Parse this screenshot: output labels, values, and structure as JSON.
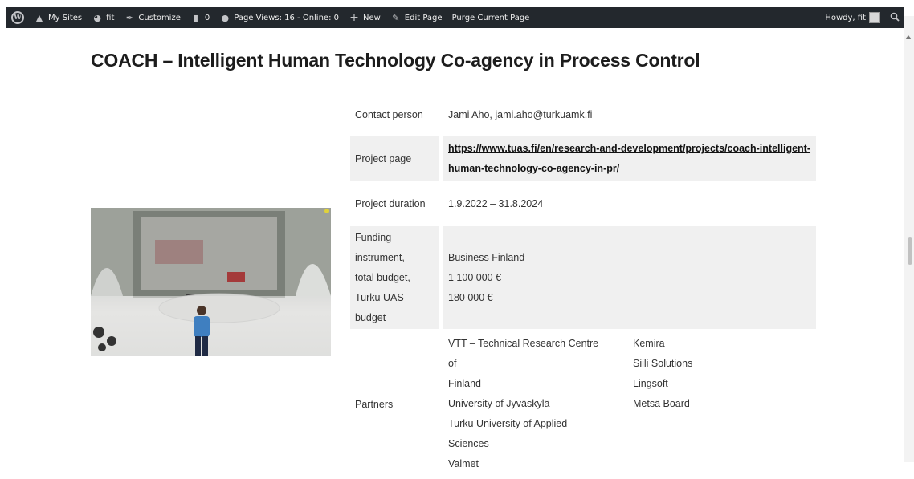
{
  "adminbar": {
    "my_sites": "My Sites",
    "site": "fit",
    "customize": "Customize",
    "comments_count": "0",
    "page_views": "Page Views: 16 - Online: 0",
    "new": "New",
    "edit_page": "Edit Page",
    "purge": "Purge Current Page",
    "howdy": "Howdy, fit"
  },
  "page": {
    "title": "COACH – Intelligent Human Technology Co-agency in Process Control"
  },
  "details": {
    "contact": {
      "label": "Contact person",
      "value": "Jami Aho, jami.aho@turkuamk.fi"
    },
    "project_page": {
      "label": "Project page",
      "link_line1": "https://www.tuas.fi/en/research-and-development/projects/coach-intelligent-",
      "link_line2": "human-technology-co-agency-in-pr/"
    },
    "duration": {
      "label": "Project duration",
      "value": "1.9.2022 – 31.8.2024"
    },
    "funding": {
      "label_lines": [
        "Funding",
        "instrument,",
        "total budget,",
        "Turku UAS",
        "budget"
      ],
      "value_lines": [
        "Business Finland",
        "1 100 000 €",
        "180 000 €"
      ]
    },
    "partners": {
      "label": "Partners",
      "col1": [
        "VTT – Technical Research Centre of",
        "Finland",
        "University of Jyväskylä",
        "Turku University of Applied Sciences",
        "Valmet"
      ],
      "col2": [
        "Kemira",
        "Siili Solutions",
        "Lingsoft",
        "Metsä Board"
      ]
    }
  },
  "colors": {
    "adminbar": "#23282d",
    "row_shade": "#f0f0f0",
    "shirt": "#3f7fc0"
  }
}
